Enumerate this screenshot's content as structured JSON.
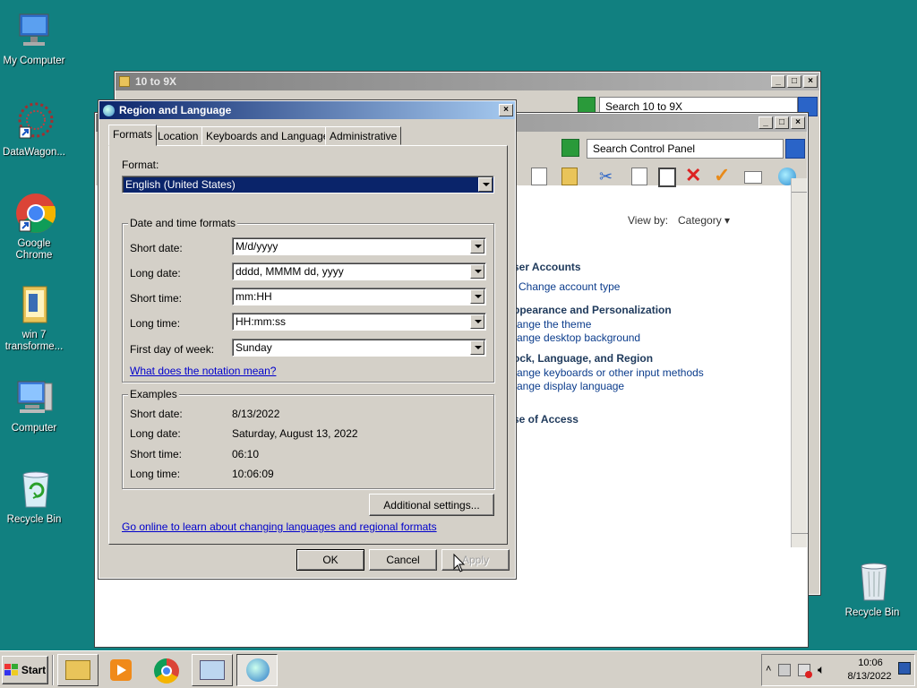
{
  "desktop_icons": [
    {
      "label": "My Computer",
      "icon": "monitor-icon"
    },
    {
      "label": "DataWagon...",
      "icon": "app-shortcut-icon"
    },
    {
      "label": "Google Chrome",
      "icon": "chrome-icon"
    },
    {
      "label": "win 7 transforme...",
      "icon": "folder-icon"
    },
    {
      "label": "Computer",
      "icon": "computer-icon"
    },
    {
      "label": "Recycle Bin",
      "icon": "recycle-bin-icon"
    },
    {
      "label": "Recycle Bin",
      "icon": "recycle-bin-icon"
    }
  ],
  "bg_window": {
    "title": "10 to 9X",
    "search_placeholder": "Search 10 to 9X"
  },
  "control_panel": {
    "search_placeholder": "Search Control Panel",
    "view_by_label": "View by:",
    "view_by_value": "Category",
    "sections": [
      {
        "heading": "ser Accounts",
        "links": [
          "Change account type"
        ]
      },
      {
        "heading": "ppearance and Personalization",
        "links": [
          "ange the theme",
          "ange desktop background"
        ]
      },
      {
        "heading": "ock, Language, and Region",
        "links": [
          "ange keyboards or other input methods",
          "ange display language"
        ]
      },
      {
        "heading": "se of Access",
        "links": []
      }
    ]
  },
  "dialog": {
    "title": "Region and Language",
    "tabs": [
      "Formats",
      "Location",
      "Keyboards and Languages",
      "Administrative"
    ],
    "format_label": "Format:",
    "format_value": "English (United States)",
    "dt_group_title": "Date and time formats",
    "dt_rows": [
      {
        "label": "Short date:",
        "value": "M/d/yyyy"
      },
      {
        "label": "Long date:",
        "value": "dddd, MMMM dd, yyyy"
      },
      {
        "label": "Short time:",
        "value": "mm:HH"
      },
      {
        "label": "Long time:",
        "value": "HH:mm:ss"
      },
      {
        "label": "First day of week:",
        "value": "Sunday"
      }
    ],
    "notation_link": "What does the notation mean?",
    "examples_title": "Examples",
    "examples": [
      {
        "label": "Short date:",
        "value": "8/13/2022"
      },
      {
        "label": "Long date:",
        "value": "Saturday, August 13, 2022"
      },
      {
        "label": "Short time:",
        "value": "06:10"
      },
      {
        "label": "Long time:",
        "value": "10:06:09"
      }
    ],
    "additional_settings": "Additional settings...",
    "online_link": "Go online to learn about changing languages and regional formats",
    "ok": "OK",
    "cancel": "Cancel",
    "apply": "Apply"
  },
  "taskbar": {
    "start_label": "Start",
    "time": "10:06",
    "date": "8/13/2022"
  }
}
